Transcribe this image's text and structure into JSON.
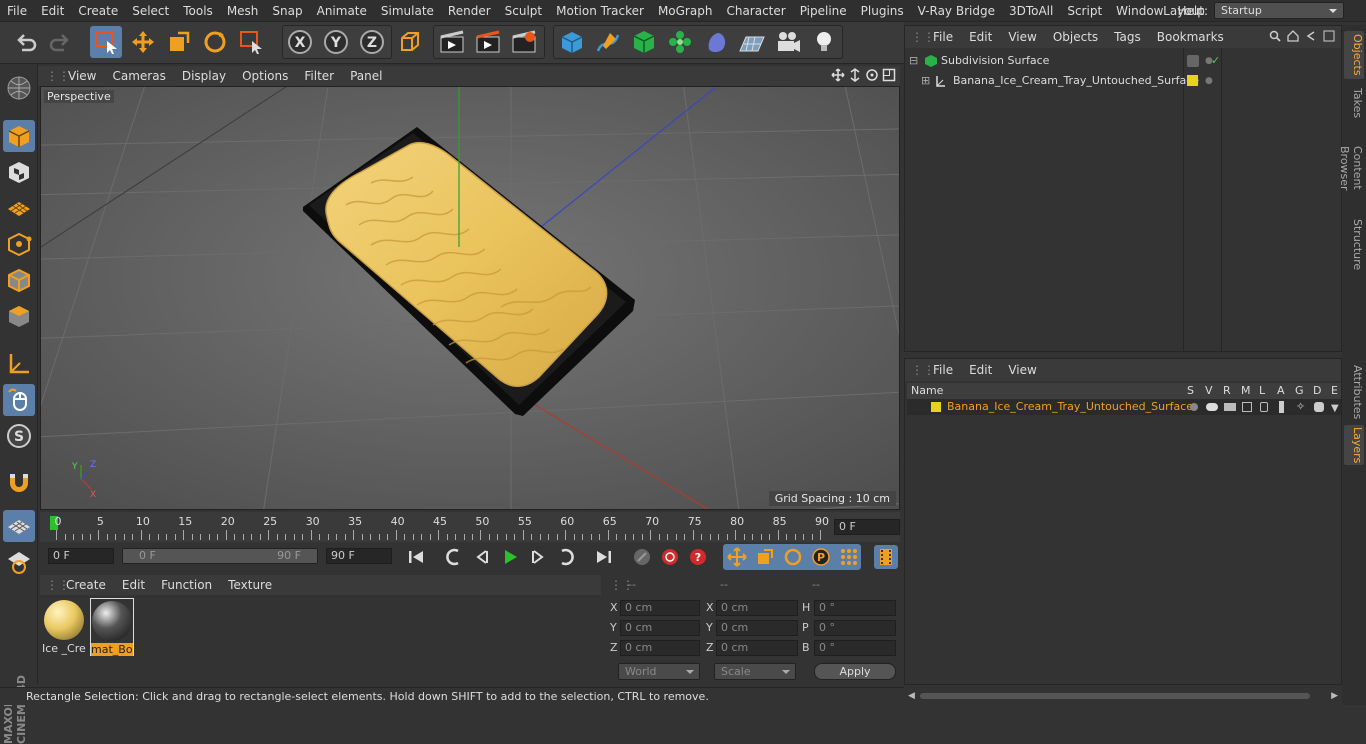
{
  "menubar": {
    "items": [
      "File",
      "Edit",
      "Create",
      "Select",
      "Tools",
      "Mesh",
      "Snap",
      "Animate",
      "Simulate",
      "Render",
      "Sculpt",
      "Motion Tracker",
      "MoGraph",
      "Character",
      "Pipeline",
      "Plugins",
      "V-Ray Bridge",
      "3DToAll",
      "Script",
      "Window",
      "Help"
    ],
    "layout_label": "Layout:",
    "layout_value": "Startup"
  },
  "viewport": {
    "menu": [
      "View",
      "Cameras",
      "Display",
      "Options",
      "Filter",
      "Panel"
    ],
    "label": "Perspective",
    "grid_spacing": "Grid Spacing : 10 cm",
    "axis_labels": {
      "y": "Y",
      "z": "Z",
      "x": "X"
    }
  },
  "timeline": {
    "ticks": [
      "0",
      "5",
      "10",
      "15",
      "20",
      "25",
      "30",
      "35",
      "40",
      "45",
      "50",
      "55",
      "60",
      "65",
      "70",
      "75",
      "80",
      "85",
      "90"
    ],
    "current_frame": "0 F"
  },
  "controls": {
    "start_field": "0 F",
    "range_start": "0 F",
    "range_end": "90 F",
    "end_field": "90 F"
  },
  "material_manager": {
    "menu": [
      "Create",
      "Edit",
      "Function",
      "Texture"
    ],
    "materials": [
      {
        "label": "Ice _Crea",
        "color": "#e9c860"
      },
      {
        "label": "mat_Bov",
        "color": "#333333"
      }
    ]
  },
  "coordinates": {
    "headers": [
      "--",
      "--",
      "--"
    ],
    "rows": [
      {
        "l1": "X",
        "v1": "0 cm",
        "l2": "X",
        "v2": "0 cm",
        "l3": "H",
        "v3": "0 °"
      },
      {
        "l1": "Y",
        "v1": "0 cm",
        "l2": "Y",
        "v2": "0 cm",
        "l3": "P",
        "v3": "0 °"
      },
      {
        "l1": "Z",
        "v1": "0 cm",
        "l2": "Z",
        "v2": "0 cm",
        "l3": "B",
        "v3": "0 °"
      }
    ],
    "mode1": "World",
    "mode2": "Scale",
    "apply": "Apply"
  },
  "status": "Rectangle Selection: Click and drag to rectangle-select elements. Hold down SHIFT to add to the selection, CTRL to remove.",
  "object_manager": {
    "menu": [
      "File",
      "Edit",
      "View",
      "Objects",
      "Tags",
      "Bookmarks"
    ],
    "objects": [
      "Subdivision Surface",
      "Banana_Ice_Cream_Tray_Untouched_Surface"
    ]
  },
  "layer_manager": {
    "menu": [
      "File",
      "Edit",
      "View"
    ],
    "columns": [
      "Name",
      "S",
      "V",
      "R",
      "M",
      "L",
      "A",
      "G",
      "D",
      "E"
    ],
    "layer_name": "Banana_Ice_Cream_Tray_Untouched_Surface",
    "layer_color": "#e8d21c"
  },
  "right_tabs": [
    "Objects",
    "Takes",
    "Content Browser",
    "Structure",
    "Attributes",
    "Layers"
  ],
  "colors": {
    "accent": "#5b7fa8",
    "highlight": "#ffaa33",
    "tray": "#111111",
    "ice_cream": "#ebc65e"
  }
}
